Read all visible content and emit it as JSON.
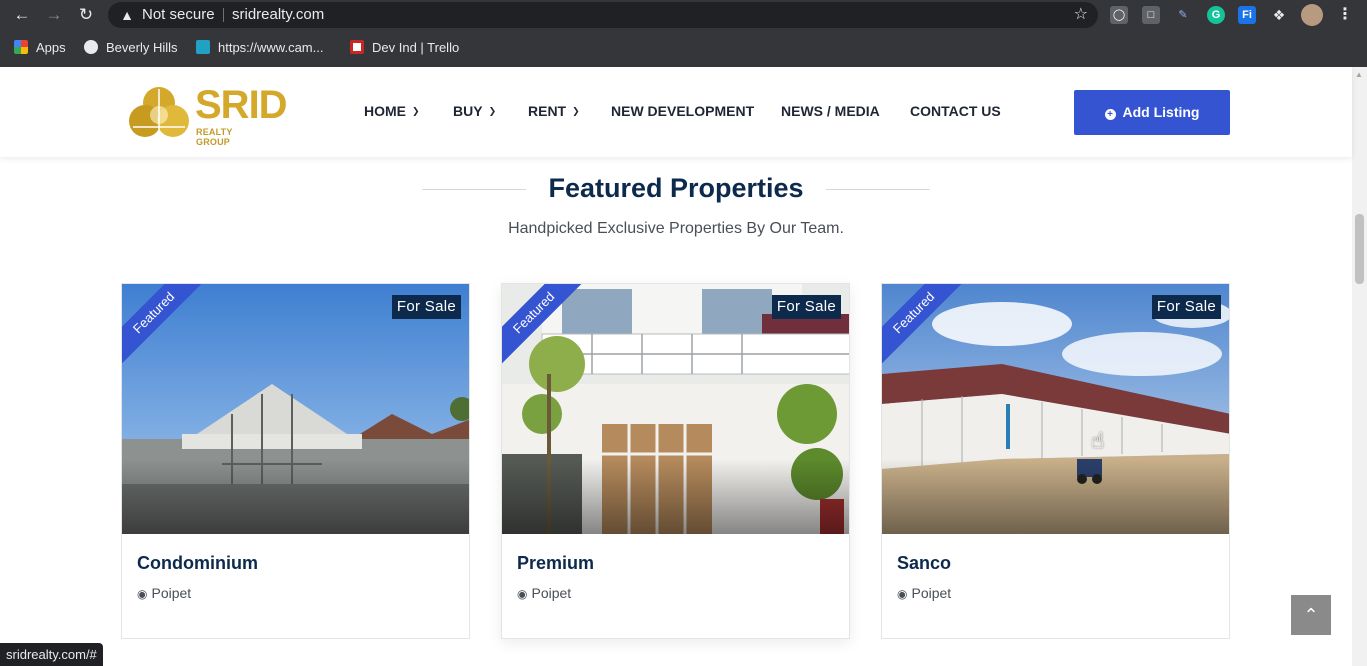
{
  "browser": {
    "security_label": "Not secure",
    "url": "sridrealty.com",
    "bookmarks": [
      "Apps",
      "Beverly Hills",
      "https://www.cam...",
      "Dev Ind | Trello"
    ],
    "status_url": "sridrealty.com/#"
  },
  "site": {
    "logo_main": "SRID",
    "logo_sub": "REALTY GROUP",
    "menu": [
      "HOME",
      "BUY",
      "RENT",
      "NEW DEVELOPMENT",
      "NEWS / MEDIA",
      "CONTACT US"
    ],
    "add_listing": "Add Listing"
  },
  "section": {
    "title": "Featured Properties",
    "subtitle": "Handpicked Exclusive Properties By Our Team."
  },
  "listings": [
    {
      "badge": "Featured",
      "status": "For Sale",
      "name": "Condominium",
      "location": "Poipet"
    },
    {
      "badge": "Featured",
      "status": "For Sale",
      "name": "Premium",
      "location": "Poipet"
    },
    {
      "badge": "Featured",
      "status": "For Sale",
      "name": "Sanco",
      "location": "Poipet"
    }
  ],
  "colors": {
    "brand_blue": "#3454d1",
    "navy": "#0d2a4d",
    "gold": "#d4a82a"
  }
}
